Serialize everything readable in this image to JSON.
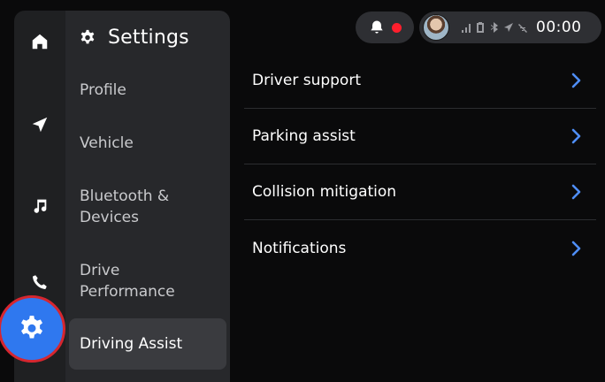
{
  "rail": {
    "items": [
      {
        "icon": "home-icon"
      },
      {
        "icon": "navigation-arrow-icon"
      },
      {
        "icon": "music-note-icon"
      },
      {
        "icon": "phone-icon"
      },
      {
        "icon": "settings-gear-icon",
        "active": true
      }
    ]
  },
  "settings": {
    "title": "Settings",
    "items": [
      {
        "label": "Profile"
      },
      {
        "label": "Vehicle"
      },
      {
        "label": "Bluetooth & Devices"
      },
      {
        "label": "Drive Performance"
      },
      {
        "label": "Driving Assist",
        "selected": true
      }
    ]
  },
  "content": {
    "rows": [
      {
        "label": "Driver support"
      },
      {
        "label": "Parking assist"
      },
      {
        "label": "Collision mitigation"
      },
      {
        "label": "Notifications"
      }
    ]
  },
  "status": {
    "clock": "00:00",
    "icons": [
      "bell-icon",
      "signal-icon",
      "battery-icon",
      "bluetooth-icon",
      "location-icon",
      "no-wifi-icon"
    ]
  },
  "colors": {
    "accent": "#2f78ef",
    "alert": "#ff1f2d",
    "highlight_ring": "#d6262f"
  }
}
